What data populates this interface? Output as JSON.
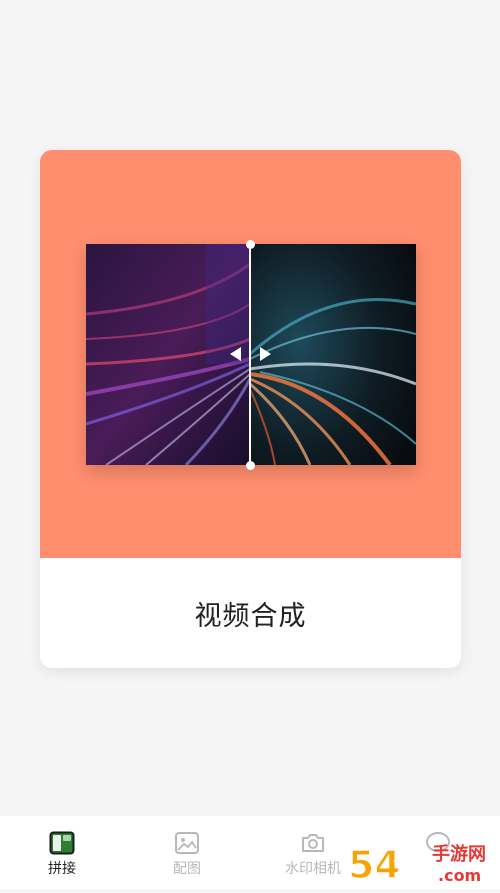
{
  "card": {
    "title": "视频合成",
    "hero_color": "#ff8e6f"
  },
  "tabs": [
    {
      "label": "拼接",
      "icon": "collage-icon",
      "active": true
    },
    {
      "label": "配图",
      "icon": "image-icon",
      "active": false
    },
    {
      "label": "水印相机",
      "icon": "camera-icon",
      "active": false
    },
    {
      "label": "",
      "icon": "chat-bubble-icon",
      "active": false
    }
  ],
  "watermark": {
    "text": "54游 手游网 .com"
  },
  "colors": {
    "background": "#f5f5f5",
    "active_tab_icon": "#2e7d32",
    "inactive": "#b8b8b8"
  }
}
